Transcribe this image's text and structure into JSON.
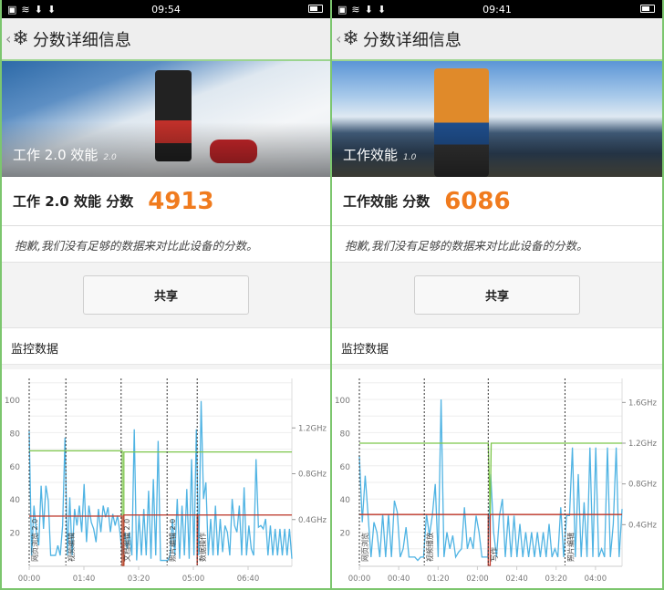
{
  "panels": [
    {
      "status": {
        "time": "09:54"
      },
      "header": {
        "title": "分数详细信息"
      },
      "hero": {
        "label": "工作 2.0 效能",
        "version": "2.0"
      },
      "score": {
        "label": "工作 2.0 效能 分数",
        "value": "4913"
      },
      "note": "抱歉,我们没有足够的数据来对比此设备的分数。",
      "share_label": "共享",
      "monitor_title": "监控数据"
    },
    {
      "status": {
        "time": "09:41"
      },
      "header": {
        "title": "分数详细信息"
      },
      "hero": {
        "label": "工作效能",
        "version": "1.0"
      },
      "score": {
        "label": "工作效能 分数",
        "value": "6086"
      },
      "note": "抱歉,我们没有足够的数据来对比此设备的分数。",
      "share_label": "共享",
      "monitor_title": "监控数据"
    }
  ],
  "colors": {
    "accent": "#f07b1e",
    "cpu": "#4fb3e3",
    "freq_max": "#7cc64a",
    "freq_min": "#c0392b"
  },
  "chart_data": [
    {
      "type": "line",
      "x_unit": "seconds",
      "xmax": 480,
      "ylim": [
        0,
        110
      ],
      "y_ticks": [
        20,
        40,
        60,
        80,
        100
      ],
      "x_ticks": [
        {
          "v": 0,
          "label": "00:00"
        },
        {
          "v": 100,
          "label": "01:40"
        },
        {
          "v": 200,
          "label": "03:20"
        },
        {
          "v": 300,
          "label": "05:00"
        },
        {
          "v": 400,
          "label": "06:40"
        }
      ],
      "y2_ticks": [
        {
          "v": 0.4,
          "label": "0.4GHz"
        },
        {
          "v": 0.8,
          "label": "0.8GHz"
        },
        {
          "v": 1.2,
          "label": "1.2GHz"
        }
      ],
      "y2max": 1.6,
      "markers": [
        {
          "t": 0,
          "label": "网页浏览 2.0"
        },
        {
          "t": 67,
          "label": "视频编辑"
        },
        {
          "t": 168,
          "label": "文档编辑 2.0"
        },
        {
          "t": 252,
          "label": "照片编辑 2.0"
        },
        {
          "t": 307,
          "label": "数据操作"
        }
      ],
      "freq_max": [
        [
          0,
          1.0
        ],
        [
          170,
          1.0
        ],
        [
          170,
          0.0
        ],
        [
          173,
          0.0
        ],
        [
          173,
          0.99
        ],
        [
          480,
          0.99
        ]
      ],
      "freq_min": [
        [
          0,
          0.43
        ],
        [
          170,
          0.43
        ],
        [
          170,
          0.0
        ],
        [
          173,
          0.0
        ],
        [
          173,
          0.44
        ],
        [
          307,
          0.44
        ],
        [
          307,
          0.0
        ],
        [
          308,
          0.44
        ],
        [
          480,
          0.44
        ]
      ],
      "cpu": [
        81,
        6,
        36,
        20,
        12,
        48,
        22,
        48,
        39,
        6,
        6,
        6,
        12,
        6,
        24,
        77,
        6,
        41,
        6,
        34,
        24,
        36,
        20,
        49,
        14,
        36,
        26,
        22,
        14,
        34,
        20,
        36,
        29,
        35,
        20,
        31,
        24,
        30,
        20,
        6,
        20,
        10,
        20,
        6,
        82,
        3,
        30,
        6,
        34,
        6,
        45,
        4,
        52,
        6,
        75,
        3,
        3,
        3,
        3,
        6,
        28,
        6,
        40,
        4,
        36,
        6,
        46,
        4,
        64,
        6,
        82,
        6,
        99,
        40,
        50,
        6,
        28,
        6,
        36,
        6,
        28,
        8,
        24,
        20,
        6,
        40,
        24,
        20,
        36,
        6,
        47,
        6,
        24,
        10,
        6,
        64,
        23,
        24,
        22,
        28,
        6,
        24,
        6,
        22,
        6,
        22,
        6,
        22,
        6,
        22,
        4
      ]
    },
    {
      "type": "line",
      "x_unit": "seconds",
      "xmax": 267,
      "ylim": [
        0,
        110
      ],
      "y_ticks": [
        20,
        40,
        60,
        80,
        100
      ],
      "x_ticks": [
        {
          "v": 0,
          "label": "00:00"
        },
        {
          "v": 40,
          "label": "00:40"
        },
        {
          "v": 80,
          "label": "01:20"
        },
        {
          "v": 120,
          "label": "02:00"
        },
        {
          "v": 160,
          "label": "02:40"
        },
        {
          "v": 200,
          "label": "03:20"
        },
        {
          "v": 240,
          "label": "04:00"
        }
      ],
      "y2_ticks": [
        {
          "v": 0.4,
          "label": "0.4GHz"
        },
        {
          "v": 0.8,
          "label": "0.8GHz"
        },
        {
          "v": 1.2,
          "label": "1.2GHz"
        },
        {
          "v": 1.6,
          "label": "1.6GHz"
        }
      ],
      "y2max": 1.8,
      "markers": [
        {
          "t": 0,
          "label": "网页浏览"
        },
        {
          "t": 66,
          "label": "视频播放"
        },
        {
          "t": 131,
          "label": "写作"
        },
        {
          "t": 209,
          "label": "照片编辑"
        }
      ],
      "freq_max": [
        [
          0,
          1.2
        ],
        [
          131,
          1.2
        ],
        [
          133,
          0.5
        ],
        [
          134,
          1.2
        ],
        [
          267,
          1.2
        ]
      ],
      "freq_min": [
        [
          0,
          0.5
        ],
        [
          131,
          0.5
        ],
        [
          131,
          0.0
        ],
        [
          133,
          0.0
        ],
        [
          133,
          0.5
        ],
        [
          267,
          0.5
        ]
      ],
      "cpu": [
        66,
        26,
        54,
        30,
        5,
        26,
        20,
        5,
        31,
        5,
        31,
        5,
        39,
        32,
        5,
        10,
        23,
        5,
        5,
        5,
        3,
        5,
        5,
        31,
        18,
        30,
        49,
        5,
        100,
        5,
        20,
        10,
        18,
        5,
        8,
        10,
        35,
        10,
        17,
        10,
        30,
        20,
        5,
        5,
        5,
        55,
        20,
        5,
        30,
        40,
        5,
        30,
        5,
        30,
        5,
        25,
        5,
        20,
        5,
        20,
        5,
        20,
        5,
        20,
        5,
        25,
        5,
        10,
        5,
        35,
        5,
        30,
        30,
        71,
        5,
        55,
        5,
        38,
        5,
        71,
        5,
        71,
        5,
        10,
        5,
        71,
        5,
        25,
        71,
        5,
        34
      ]
    }
  ]
}
